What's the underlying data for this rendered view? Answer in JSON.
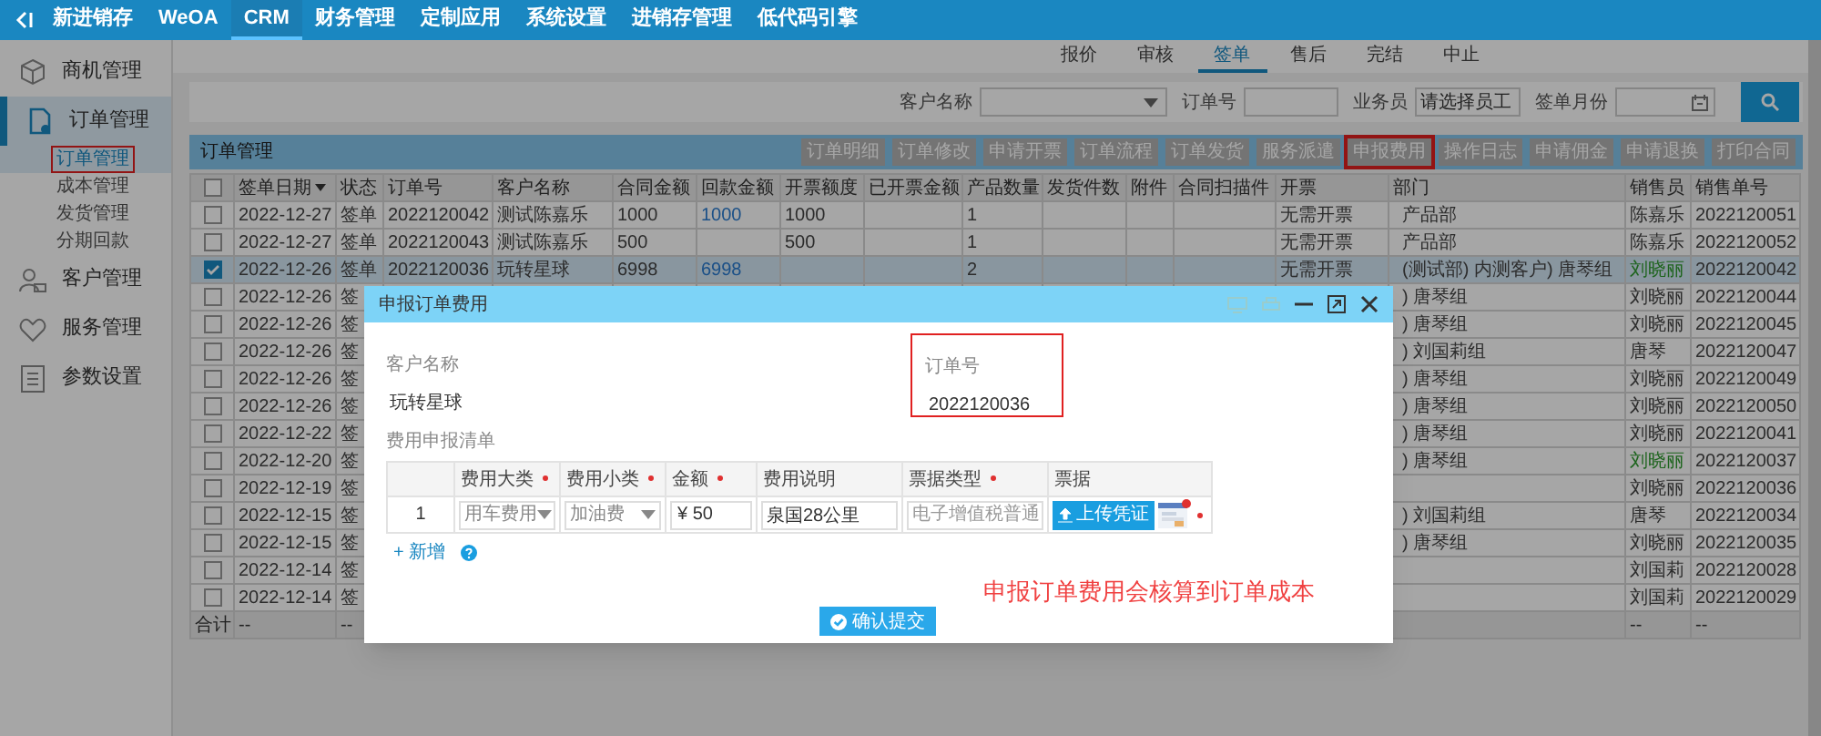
{
  "top_nav": {
    "items": [
      {
        "label": "新进销存",
        "selected": false
      },
      {
        "label": "WeOA",
        "selected": false
      },
      {
        "label": "CRM",
        "selected": true
      },
      {
        "label": "财务管理",
        "selected": false
      },
      {
        "label": "定制应用",
        "selected": false
      },
      {
        "label": "系统设置",
        "selected": false
      },
      {
        "label": "进销存管理",
        "selected": false
      },
      {
        "label": "低代码引擎",
        "selected": false
      }
    ]
  },
  "sidebar": {
    "items": [
      {
        "label": "商机管理",
        "selected": false
      },
      {
        "label": "订单管理",
        "selected": true,
        "expanded": true,
        "children": [
          {
            "label": "订单管理",
            "selected": true,
            "annotated": true
          },
          {
            "label": "成本管理",
            "selected": false,
            "annotated": false
          },
          {
            "label": "发货管理",
            "selected": false,
            "annotated": false
          },
          {
            "label": "分期回款",
            "selected": false,
            "annotated": false
          }
        ]
      },
      {
        "label": "客户管理",
        "selected": false
      },
      {
        "label": "服务管理",
        "selected": false
      },
      {
        "label": "参数设置",
        "selected": false
      }
    ]
  },
  "tabs": [
    {
      "label": "报价",
      "selected": false
    },
    {
      "label": "审核",
      "selected": false
    },
    {
      "label": "签单",
      "selected": true
    },
    {
      "label": "售后",
      "selected": false
    },
    {
      "label": "完结",
      "selected": false
    },
    {
      "label": "中止",
      "selected": false
    }
  ],
  "filters": {
    "customer_label": "客户名称",
    "order_no_label": "订单号",
    "salesperson_label": "业务员",
    "salesperson_placeholder": "请选择员工",
    "month_label": "签单月份"
  },
  "toolbar": {
    "title": "订单管理",
    "buttons": [
      {
        "label": "订单明细",
        "annotated": false
      },
      {
        "label": "订单修改",
        "annotated": false
      },
      {
        "label": "申请开票",
        "annotated": false
      },
      {
        "label": "订单流程",
        "annotated": false
      },
      {
        "label": "订单发货",
        "annotated": false
      },
      {
        "label": "服务派遣",
        "annotated": false
      },
      {
        "label": "申报费用",
        "annotated": true
      },
      {
        "label": "操作日志",
        "annotated": false
      },
      {
        "label": "申请佣金",
        "annotated": false
      },
      {
        "label": "申请退换",
        "annotated": false
      },
      {
        "label": "打印合同",
        "annotated": false
      }
    ]
  },
  "table": {
    "all_checked": false,
    "columns": [
      {
        "label": "签单日期",
        "sorted": true
      },
      {
        "label": "状态"
      },
      {
        "label": "订单号"
      },
      {
        "label": "客户名称"
      },
      {
        "label": "合同金额"
      },
      {
        "label": "回款金额"
      },
      {
        "label": "开票额度"
      },
      {
        "label": "已开票金额"
      },
      {
        "label": "产品数量"
      },
      {
        "label": "发货件数"
      },
      {
        "label": "附件"
      },
      {
        "label": "合同扫描件"
      },
      {
        "label": "开票"
      },
      {
        "label": "部门"
      },
      {
        "label": "销售员"
      },
      {
        "label": "销售单号"
      }
    ],
    "rows": [
      {
        "checked": false,
        "paid_link": true,
        "salesperson_link": false,
        "cells": [
          "2022-12-27",
          "签单",
          "2022120042",
          "测试陈嘉乐",
          "1000",
          "1000",
          "1000",
          null,
          "1",
          null,
          null,
          null,
          "无需开票",
          "产品部",
          "陈嘉乐",
          "2022120051"
        ]
      },
      {
        "checked": false,
        "salesperson_link": false,
        "cells": [
          "2022-12-27",
          "签单",
          "2022120043",
          "测试陈嘉乐",
          "500",
          null,
          "500",
          null,
          "1",
          null,
          null,
          null,
          "无需开票",
          "产品部",
          "陈嘉乐",
          "2022120052"
        ]
      },
      {
        "checked": true,
        "paid_link": true,
        "salesperson_link": true,
        "cells": [
          "2022-12-26",
          "签单",
          "2022120036",
          "玩转星球",
          "6998",
          "6998",
          null,
          null,
          "2",
          null,
          null,
          null,
          "无需开票",
          "(测试部) 内测客户) 唐琴组",
          "刘晓丽",
          "2022120042"
        ]
      },
      {
        "checked": false,
        "salesperson_link": false,
        "cells": [
          "2022-12-26",
          "签",
          null,
          null,
          null,
          null,
          null,
          null,
          null,
          null,
          null,
          null,
          null,
          ") 唐琴组",
          "刘晓丽",
          "2022120044"
        ]
      },
      {
        "checked": false,
        "salesperson_link": false,
        "cells": [
          "2022-12-26",
          "签",
          null,
          null,
          null,
          null,
          null,
          null,
          null,
          null,
          null,
          null,
          null,
          ") 唐琴组",
          "刘晓丽",
          "2022120045"
        ]
      },
      {
        "checked": false,
        "salesperson_link": false,
        "cells": [
          "2022-12-26",
          "签",
          null,
          null,
          null,
          null,
          null,
          null,
          null,
          null,
          null,
          null,
          null,
          ") 刘国莉组",
          "唐琴",
          "2022120047"
        ]
      },
      {
        "checked": false,
        "salesperson_link": false,
        "cells": [
          "2022-12-26",
          "签",
          null,
          null,
          null,
          null,
          null,
          null,
          null,
          null,
          null,
          null,
          null,
          ") 唐琴组",
          "刘晓丽",
          "2022120049"
        ]
      },
      {
        "checked": false,
        "salesperson_link": false,
        "cells": [
          "2022-12-26",
          "签",
          null,
          null,
          null,
          null,
          null,
          null,
          null,
          null,
          null,
          null,
          null,
          ") 唐琴组",
          "刘晓丽",
          "2022120050"
        ]
      },
      {
        "checked": false,
        "salesperson_link": false,
        "cells": [
          "2022-12-22",
          "签",
          null,
          null,
          null,
          null,
          null,
          null,
          null,
          null,
          null,
          null,
          null,
          ") 唐琴组",
          "刘晓丽",
          "2022120041"
        ]
      },
      {
        "checked": false,
        "salesperson_link": true,
        "cells": [
          "2022-12-20",
          "签",
          null,
          null,
          null,
          null,
          null,
          null,
          null,
          null,
          null,
          null,
          null,
          ") 唐琴组",
          "刘晓丽",
          "2022120037"
        ]
      },
      {
        "checked": false,
        "salesperson_link": false,
        "cells": [
          "2022-12-19",
          "签",
          null,
          null,
          null,
          null,
          null,
          null,
          null,
          null,
          null,
          null,
          null,
          null,
          "刘晓丽",
          "2022120036"
        ]
      },
      {
        "checked": false,
        "salesperson_link": false,
        "cells": [
          "2022-12-15",
          "签",
          null,
          null,
          null,
          null,
          null,
          null,
          null,
          null,
          null,
          null,
          null,
          ") 刘国莉组",
          "唐琴",
          "2022120034"
        ]
      },
      {
        "checked": false,
        "salesperson_link": false,
        "cells": [
          "2022-12-15",
          "签",
          null,
          null,
          null,
          null,
          null,
          null,
          null,
          null,
          null,
          null,
          null,
          ") 唐琴组",
          "刘晓丽",
          "2022120035"
        ]
      },
      {
        "checked": false,
        "salesperson_link": false,
        "cells": [
          "2022-12-14",
          "签",
          null,
          null,
          null,
          null,
          null,
          null,
          null,
          null,
          null,
          null,
          null,
          null,
          "刘国莉",
          "2022120028"
        ]
      },
      {
        "checked": false,
        "salesperson_link": false,
        "cells": [
          "2022-12-14",
          "签",
          null,
          null,
          null,
          null,
          null,
          null,
          null,
          null,
          null,
          null,
          null,
          null,
          "刘国莉",
          "2022120029"
        ]
      }
    ],
    "total_row": {
      "label": "合计",
      "cells": [
        "--",
        "--",
        null,
        null,
        null,
        null,
        null,
        null,
        null,
        null,
        null,
        null,
        null,
        null,
        "--",
        "--"
      ]
    }
  },
  "dialog": {
    "title": "申报订单费用",
    "customer_label": "客户名称",
    "customer_value": "玩转星球",
    "order_no_label": "订单号",
    "order_no_value": "2022120036",
    "order_no_annotated": true,
    "list_title": "费用申报清单",
    "columns": [
      {
        "label": "费用大类",
        "required": true
      },
      {
        "label": "费用小类",
        "required": true
      },
      {
        "label": "金额",
        "required": true
      },
      {
        "label": "费用说明",
        "required": false
      },
      {
        "label": "票据类型",
        "required": true
      },
      {
        "label": "票据",
        "required": false
      }
    ],
    "rows": [
      {
        "index": "1",
        "category": "用车费用",
        "subcategory": "加油费",
        "currency": "¥",
        "amount": "50",
        "description": "泉国28公里",
        "invoice_type": "电子增值税普通",
        "upload_label": "上传凭证",
        "has_receipt": true,
        "receipt_required": true
      }
    ],
    "add_link": "+ 新增",
    "submit_label": "确认提交"
  },
  "annotation": "申报订单费用会核算到订单成本"
}
